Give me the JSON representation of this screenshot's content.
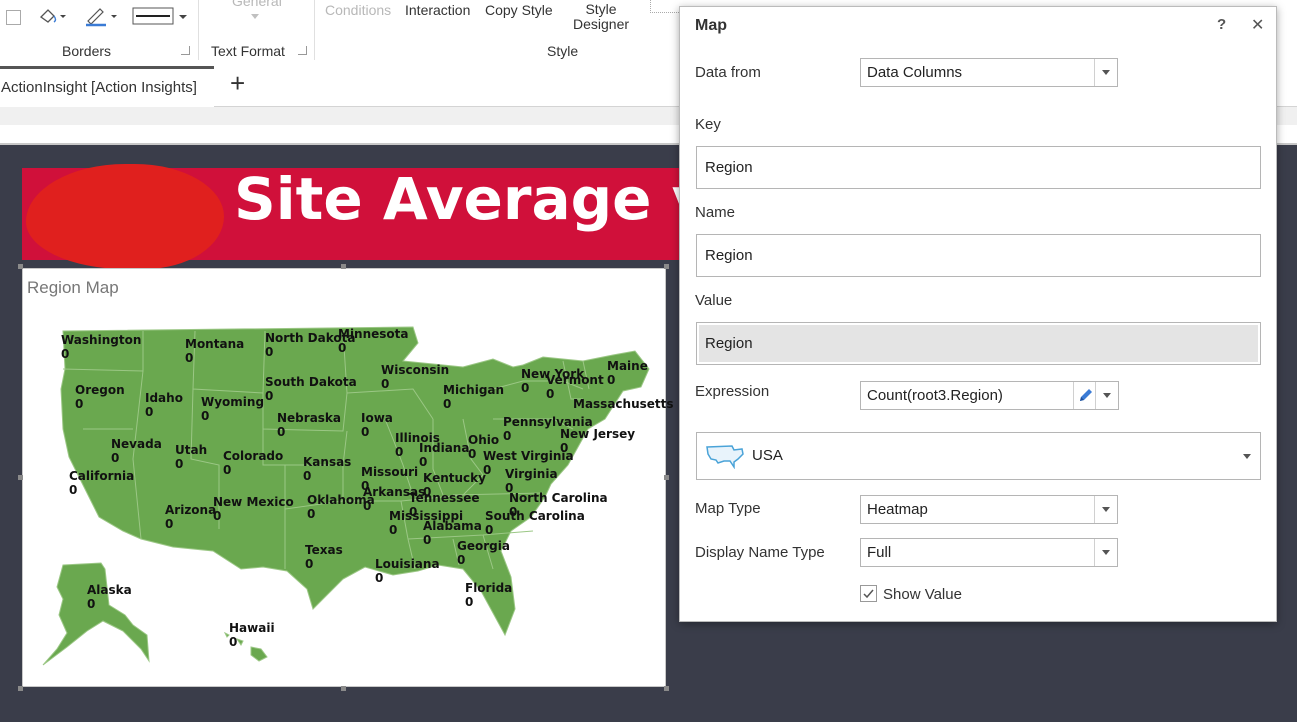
{
  "ribbon": {
    "general_label": "General",
    "conditions_label": "Conditions",
    "interaction_label": "Interaction",
    "copy_style_label": "Copy Style",
    "style_designer_line1": "Style",
    "style_designer_line2": "Designer",
    "groups": {
      "borders": "Borders",
      "text_format": "Text Format",
      "style": "Style"
    }
  },
  "tabs": {
    "active_tab": "ActionInsight [Action Insights]",
    "add_tab": "+"
  },
  "banner": {
    "title": "Site Average vs"
  },
  "map_widget": {
    "title": "Region Map",
    "fill_color": "#6aa84f",
    "states": [
      {
        "id": "washington",
        "name": "Washington",
        "value": "0"
      },
      {
        "id": "montana",
        "name": "Montana",
        "value": "0"
      },
      {
        "id": "north-dakota",
        "name": "North Dakota",
        "value": "0"
      },
      {
        "id": "minnesota",
        "name": "Minnesota",
        "value": "0"
      },
      {
        "id": "oregon",
        "name": "Oregon",
        "value": "0"
      },
      {
        "id": "idaho",
        "name": "Idaho",
        "value": "0"
      },
      {
        "id": "wyoming",
        "name": "Wyoming",
        "value": "0"
      },
      {
        "id": "south-dakota",
        "name": "South Dakota",
        "value": "0"
      },
      {
        "id": "wisconsin",
        "name": "Wisconsin",
        "value": "0"
      },
      {
        "id": "michigan",
        "name": "Michigan",
        "value": "0"
      },
      {
        "id": "new-york",
        "name": "New York",
        "value": "0"
      },
      {
        "id": "vermont",
        "name": "Vermont",
        "value": "0"
      },
      {
        "id": "maine",
        "name": "Maine",
        "value": "0"
      },
      {
        "id": "massachusetts",
        "name": "Massachusetts",
        "value": ""
      },
      {
        "id": "nevada",
        "name": "Nevada",
        "value": "0"
      },
      {
        "id": "utah",
        "name": "Utah",
        "value": "0"
      },
      {
        "id": "colorado",
        "name": "Colorado",
        "value": "0"
      },
      {
        "id": "nebraska",
        "name": "Nebraska",
        "value": "0"
      },
      {
        "id": "iowa",
        "name": "Iowa",
        "value": "0"
      },
      {
        "id": "illinois",
        "name": "Illinois",
        "value": "0"
      },
      {
        "id": "indiana",
        "name": "Indiana",
        "value": "0"
      },
      {
        "id": "ohio",
        "name": "Ohio",
        "value": "0"
      },
      {
        "id": "pennsylvania",
        "name": "Pennsylvania",
        "value": "0"
      },
      {
        "id": "new-jersey",
        "name": "New Jersey",
        "value": "0"
      },
      {
        "id": "california",
        "name": "California",
        "value": "0"
      },
      {
        "id": "kansas",
        "name": "Kansas",
        "value": "0"
      },
      {
        "id": "missouri",
        "name": "Missouri",
        "value": "0"
      },
      {
        "id": "kentucky",
        "name": "Kentucky",
        "value": "0"
      },
      {
        "id": "west-virginia",
        "name": "West Virginia",
        "value": "0"
      },
      {
        "id": "virginia",
        "name": "Virginia",
        "value": "0"
      },
      {
        "id": "arizona",
        "name": "Arizona",
        "value": "0"
      },
      {
        "id": "new-mexico",
        "name": "New Mexico",
        "value": "0"
      },
      {
        "id": "oklahoma",
        "name": "Oklahoma",
        "value": "0"
      },
      {
        "id": "arkansas",
        "name": "Arkansas",
        "value": "0"
      },
      {
        "id": "tennessee",
        "name": "Tennessee",
        "value": "0"
      },
      {
        "id": "north-carolina",
        "name": "North Carolina",
        "value": "0"
      },
      {
        "id": "mississippi",
        "name": "Mississippi",
        "value": "0"
      },
      {
        "id": "alabama",
        "name": "Alabama",
        "value": "0"
      },
      {
        "id": "south-carolina",
        "name": "South Carolina",
        "value": "0"
      },
      {
        "id": "georgia",
        "name": "Georgia",
        "value": "0"
      },
      {
        "id": "texas",
        "name": "Texas",
        "value": "0"
      },
      {
        "id": "louisiana",
        "name": "Louisiana",
        "value": "0"
      },
      {
        "id": "florida",
        "name": "Florida",
        "value": "0"
      },
      {
        "id": "alaska",
        "name": "Alaska",
        "value": "0"
      },
      {
        "id": "hawaii",
        "name": "Hawaii",
        "value": "0"
      }
    ]
  },
  "dialog": {
    "title": "Map",
    "help_label": "?",
    "close_label": "✕",
    "data_from": {
      "label": "Data from",
      "value": "Data Columns"
    },
    "key": {
      "label": "Key",
      "value": "Region"
    },
    "name": {
      "label": "Name",
      "value": "Region"
    },
    "value_field": {
      "label": "Value",
      "value": "Region"
    },
    "expression": {
      "label": "Expression",
      "value": "Count(root3.Region)"
    },
    "map_select": {
      "value": "USA",
      "icon": "usa-map-icon"
    },
    "map_type": {
      "label": "Map Type",
      "value": "Heatmap"
    },
    "display_name_type": {
      "label": "Display Name Type",
      "value": "Full"
    },
    "show_value": {
      "label": "Show Value",
      "checked": true
    }
  }
}
